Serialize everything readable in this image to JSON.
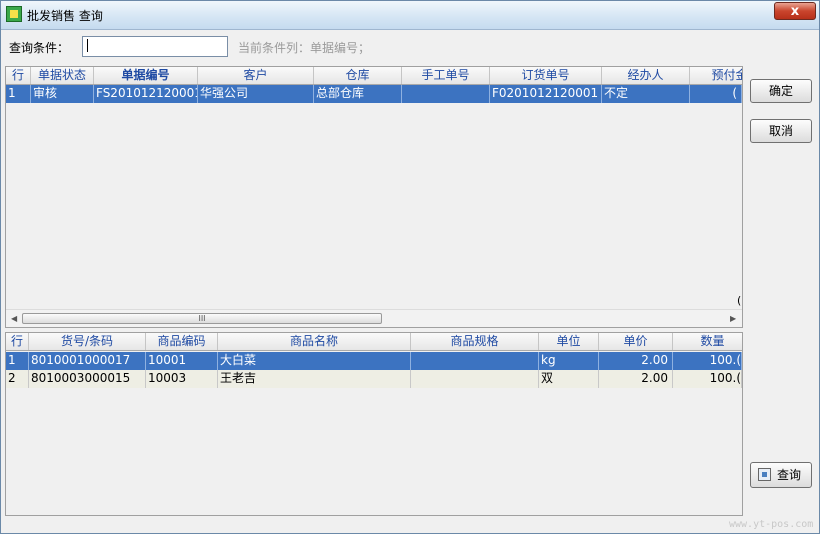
{
  "window": {
    "title": "批发销售 查询",
    "close_label": "x"
  },
  "filter": {
    "label": "查询条件：",
    "value": "",
    "hint": "当前条件列：单据编号；"
  },
  "orders": {
    "columns": [
      "行",
      "单据状态",
      "单据编号",
      "客户",
      "仓库",
      "手工单号",
      "订货单号",
      "经办人",
      "预付金"
    ],
    "rows": [
      [
        "1",
        "审核",
        "FS201012120001",
        "华强公司",
        "总部仓库",
        "",
        "F0201012120001",
        "不定",
        "("
      ]
    ],
    "footer_clip": "("
  },
  "items": {
    "columns": [
      "行",
      "货号/条码",
      "商品编码",
      "商品名称",
      "商品规格",
      "单位",
      "单价",
      "数量"
    ],
    "rows": [
      [
        "1",
        "8010001000017",
        "10001",
        "大白菜",
        "",
        "kg",
        "2.00",
        "100.("
      ],
      [
        "2",
        "8010003000015",
        "10003",
        "王老吉",
        "",
        "双",
        "2.00",
        "100.("
      ]
    ]
  },
  "buttons": {
    "ok": "确定",
    "cancel": "取消",
    "query": "查询"
  },
  "scrollbar": {
    "thumb_grip": "III",
    "left_arrow": "◀",
    "right_arrow": "▶"
  },
  "watermark": "www.yt-pos.com"
}
